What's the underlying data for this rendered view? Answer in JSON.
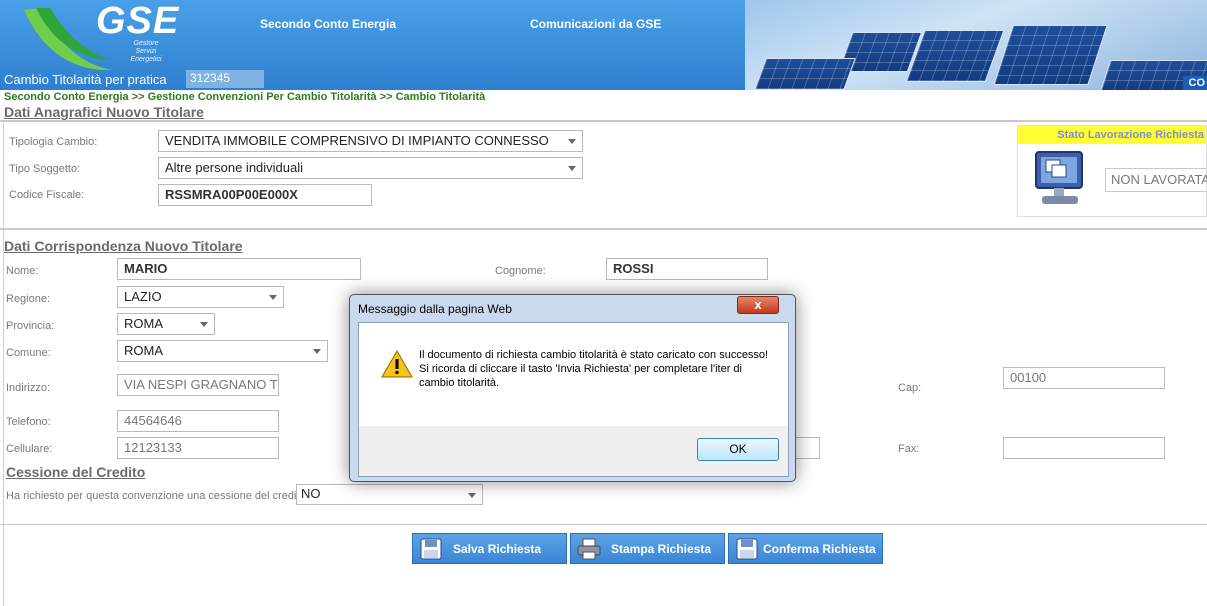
{
  "header": {
    "logo_text": "GSE",
    "logo_sub_lines": [
      "Gestore",
      "Servizi",
      "Energetici"
    ],
    "nav": [
      "Secondo Conto Energia",
      "Comunicazioni da GSE"
    ],
    "page_title": "Cambio Titolarità per pratica",
    "pratica_number": "312345",
    "corner_tag": "CO"
  },
  "breadcrumb": "Secondo Conto Energia >> Gestione Convenzioni Per Cambio Titolarità >> Cambio Titolarità",
  "section1": {
    "title": "Dati Anagrafici Nuovo Titolare",
    "tipologia_label": "Tipologia Cambio:",
    "tipologia_value": "VENDITA IMMOBILE COMPRENSIVO DI IMPIANTO CONNESSO",
    "soggetto_label": "Tipo Soggetto:",
    "soggetto_value": "Altre persone individuali",
    "cf_label": "Codice Fiscale:",
    "cf_value": "RSSMRA00P00E000X"
  },
  "stato": {
    "title": "Stato Lavorazione Richiesta",
    "value": "NON LAVORATA"
  },
  "section2": {
    "title": "Dati Corrispondenza Nuovo Titolare",
    "nome_label": "Nome:",
    "nome_value": "MARIO",
    "cognome_label": "Cognome:",
    "cognome_value": "ROSSI",
    "regione_label": "Regione:",
    "regione_value": "LAZIO",
    "provincia_label": "Provincia:",
    "provincia_value": "ROMA",
    "comune_label": "Comune:",
    "comune_value": "ROMA",
    "indirizzo_label": "Indirizzo:",
    "indirizzo_value": "VIA NESPI GRAGNANO TRE",
    "cap_label": "Cap:",
    "cap_value": "00100",
    "telefono_label": "Telefono:",
    "telefono_value": "44564646",
    "cellulare_label": "Cellulare:",
    "cellulare_value": "12123133",
    "fax_label": "Fax:",
    "fax_value": ""
  },
  "section3": {
    "title": "Cessione del Credito",
    "question": "Ha richiesto per questa convenzione una cessione del credito?",
    "value": "NO"
  },
  "buttons": {
    "salva": "Salva Richiesta",
    "stampa": "Stampa Richiesta",
    "conferma": "Conferma Richiesta"
  },
  "dialog": {
    "title": "Messaggio dalla pagina Web",
    "close": "x",
    "message_line1": "Il documento di richiesta cambio titolarità è stato caricato con successo!",
    "message_line2": "Si ricorda di cliccare il tasto 'Invia Richiesta' per completare l'iter di cambio titolarità.",
    "ok": "OK"
  },
  "colors": {
    "header_blue": "#3c8fd6",
    "breadcrumb_green": "#2f7a1f",
    "stato_yellow": "#ffff33",
    "button_blue": "#4a94dc"
  }
}
